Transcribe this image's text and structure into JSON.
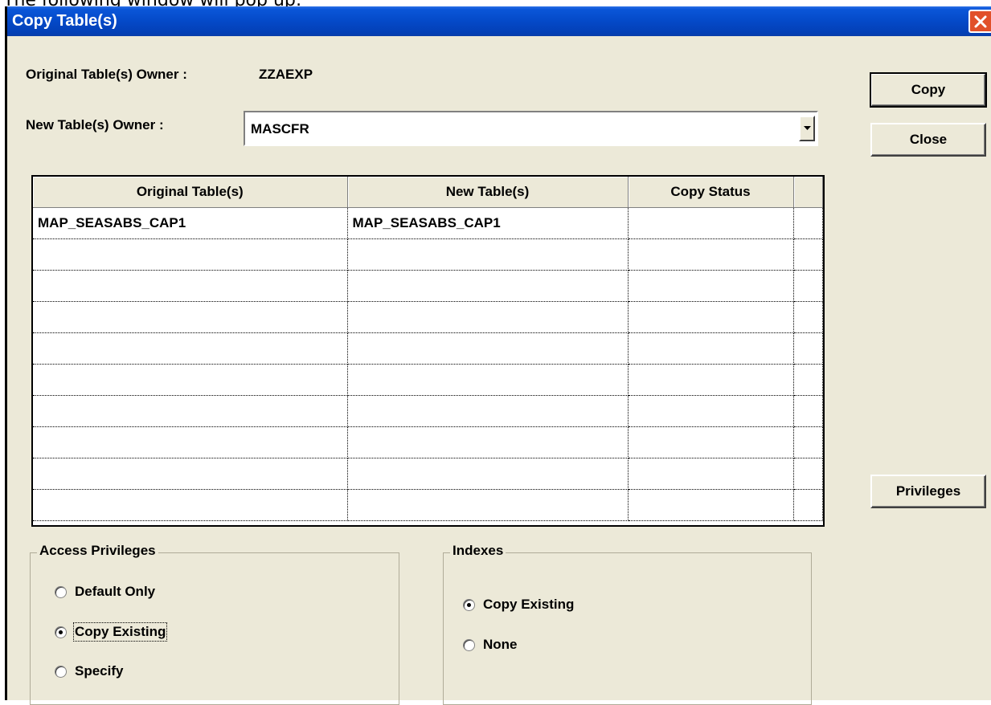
{
  "caption": "The following window will pop up:",
  "window": {
    "title": "Copy Table(s)"
  },
  "form": {
    "original_owner_label": "Original Table(s) Owner :",
    "original_owner_value": "ZZAEXP",
    "new_owner_label": "New Table(s) Owner :",
    "new_owner_value": "MASCFR"
  },
  "buttons": {
    "copy": "Copy",
    "close": "Close",
    "privileges": "Privileges"
  },
  "grid": {
    "columns": [
      "Original Table(s)",
      "New Table(s)",
      "Copy Status"
    ],
    "rows": [
      [
        "MAP_SEASABS_CAP1",
        "MAP_SEASABS_CAP1",
        ""
      ],
      [
        "",
        "",
        ""
      ],
      [
        "",
        "",
        ""
      ],
      [
        "",
        "",
        ""
      ],
      [
        "",
        "",
        ""
      ],
      [
        "",
        "",
        ""
      ],
      [
        "",
        "",
        ""
      ],
      [
        "",
        "",
        ""
      ],
      [
        "",
        "",
        ""
      ],
      [
        "",
        "",
        ""
      ]
    ]
  },
  "access_privileges": {
    "title": "Access Privileges",
    "options": [
      "Default Only",
      "Copy Existing",
      "Specify"
    ],
    "selected": "Copy Existing"
  },
  "indexes": {
    "title": "Indexes",
    "options": [
      "Copy Existing",
      "None"
    ],
    "selected": "Copy Existing"
  },
  "colors": {
    "titlebar": "#0449c8",
    "close_button": "#e1502a",
    "dialog_bg": "#ece9d8"
  },
  "icons": {
    "close": "close-icon",
    "dropdown": "chevron-down-icon"
  }
}
